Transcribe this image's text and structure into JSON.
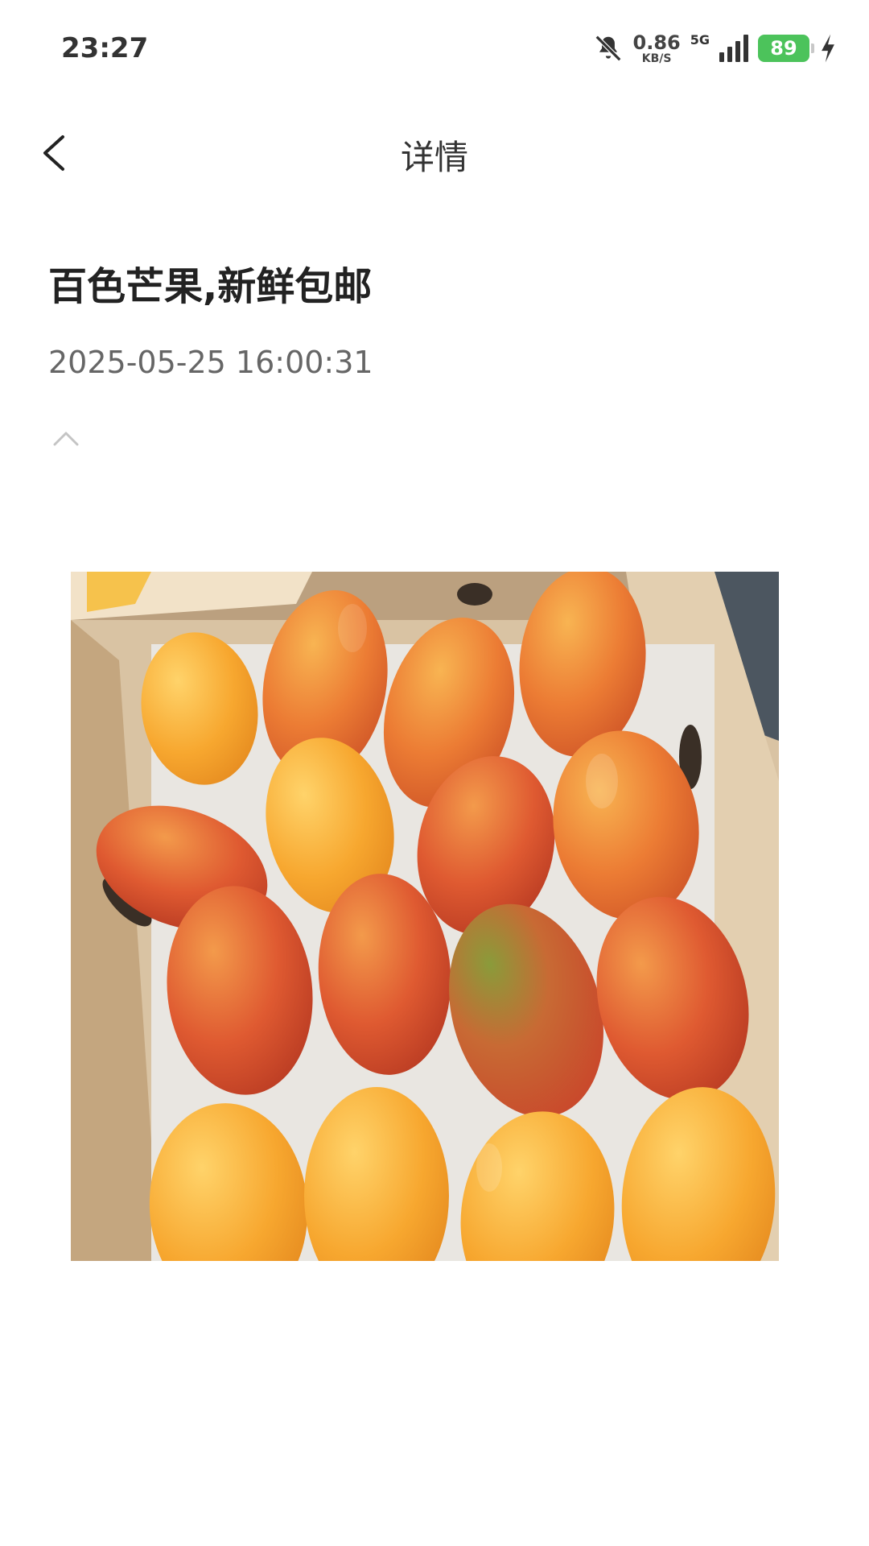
{
  "status_bar": {
    "time": "23:27",
    "net_speed_value": "0.86",
    "net_speed_unit": "KB/S",
    "network_type": "5G",
    "battery_level": "89",
    "icons": [
      "bell-muted-icon",
      "signal-icon",
      "battery-icon",
      "charging-icon"
    ]
  },
  "nav": {
    "title": "详情",
    "back_icon": "chevron-left-icon"
  },
  "post": {
    "title": "百色芒果,新鲜包邮",
    "date": "2025-05-25 16:00:31",
    "collapse_icon": "chevron-up-icon",
    "image_subject": "mango-box-photo"
  },
  "colors": {
    "battery": "#4cc35b",
    "text_primary": "#222222",
    "text_secondary": "#666666"
  }
}
